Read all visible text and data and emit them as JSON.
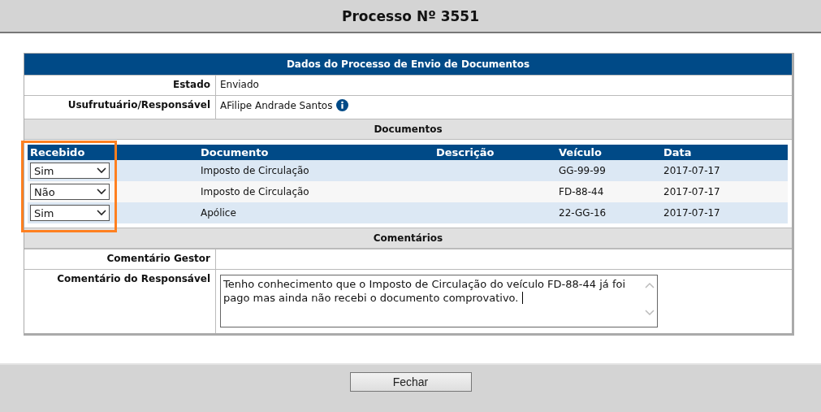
{
  "title": "Processo Nº 3551",
  "panel": {
    "title": "Dados do Processo de Envio de Documentos",
    "fields": [
      {
        "label": "Estado",
        "value": "Enviado",
        "info": false
      },
      {
        "label": "Usufrutuário/Responsável",
        "value": "AFilipe Andrade Santos",
        "info": true
      }
    ]
  },
  "documents": {
    "title": "Documentos",
    "columns": [
      "Recebido",
      "Documento",
      "Descrição",
      "Veículo",
      "Data"
    ],
    "recebido_highlighted": true,
    "rows": [
      {
        "recebido": "Sim",
        "documento": "Imposto de Circulação",
        "veiculo": "GG-99-99",
        "data": "2017-07-17"
      },
      {
        "recebido": "Não",
        "documento": "Imposto de Circulação",
        "veiculo": "FD-88-44",
        "data": "2017-07-17"
      },
      {
        "recebido": "Sim",
        "documento": "Apólice",
        "veiculo": "22-GG-16",
        "data": "2017-07-17"
      }
    ]
  },
  "comments": {
    "title": "Comentários",
    "gestor_label": "Comentário Gestor",
    "responsavel_label": "Comentário do Responsável",
    "responsavel_value": "Tenho conhecimento que o Imposto de Circulação do veículo FD-88-44 já foi pago mas ainda não recebi o documento comprovativo. "
  },
  "close_button": "Fechar"
}
